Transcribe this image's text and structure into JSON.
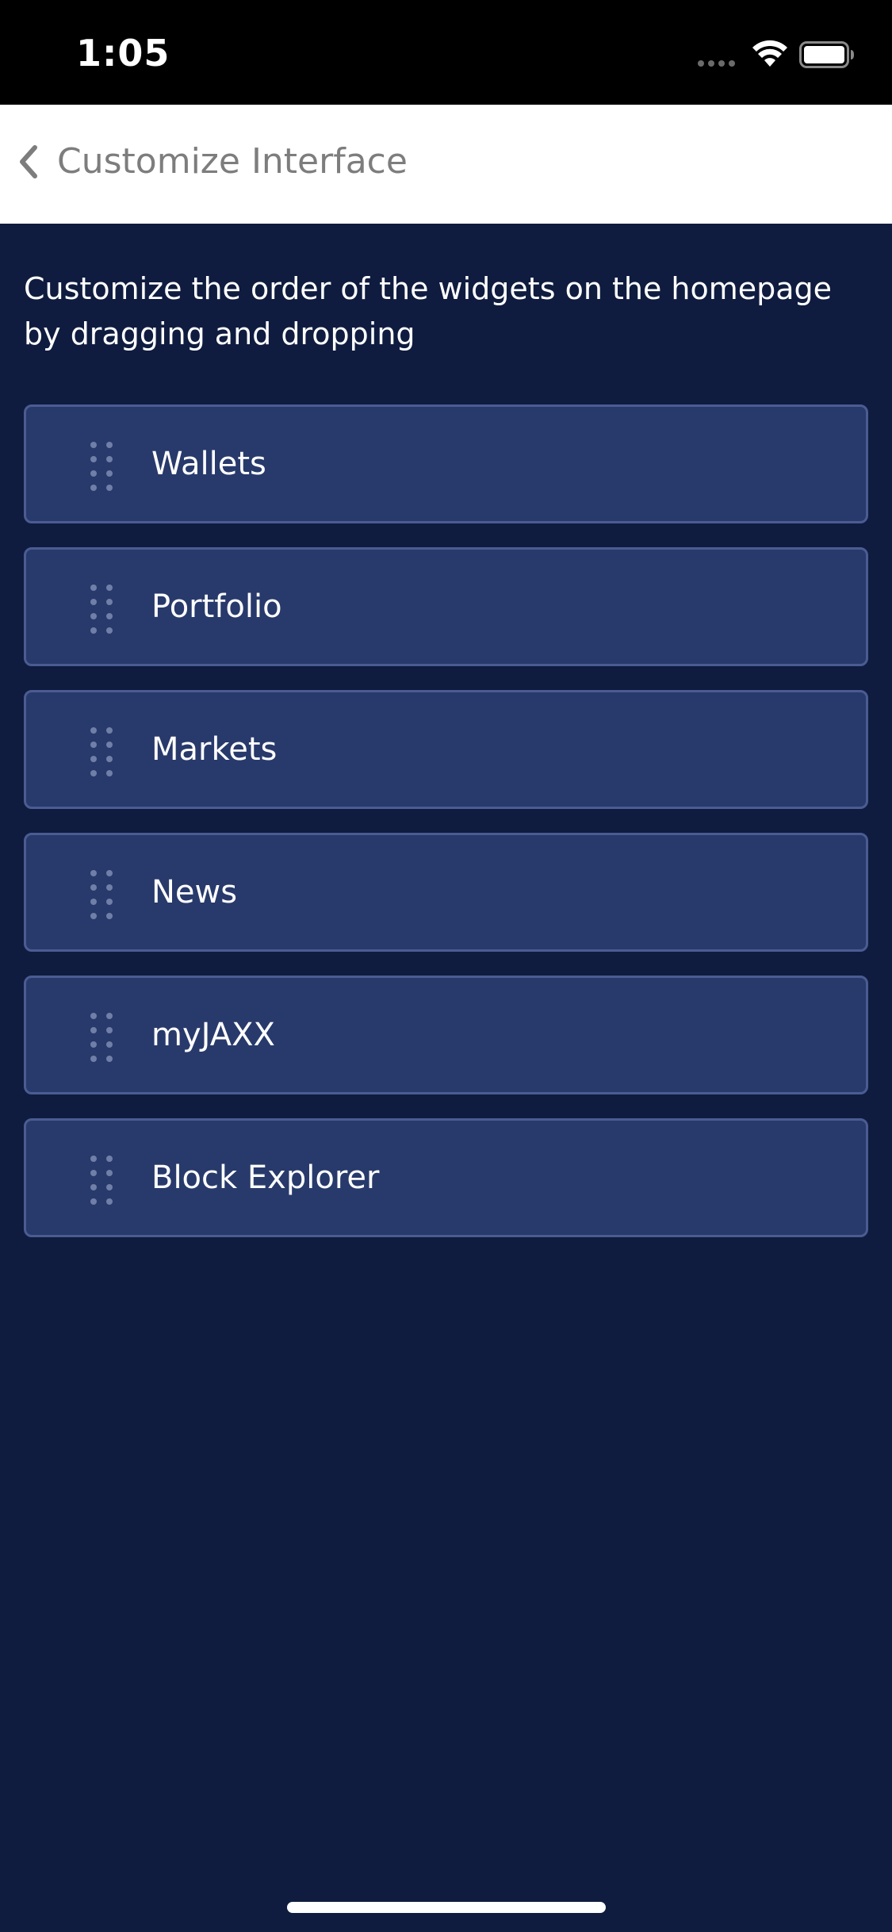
{
  "status_bar": {
    "time": "1:05"
  },
  "header": {
    "title": "Customize Interface",
    "back_icon": "chevron-left-icon"
  },
  "description": "Customize the order of the widgets on the homepage by dragging and dropping",
  "widgets": [
    {
      "label": "Wallets"
    },
    {
      "label": "Portfolio"
    },
    {
      "label": "Markets"
    },
    {
      "label": "News"
    },
    {
      "label": "myJAXX"
    },
    {
      "label": "Block Explorer"
    }
  ],
  "colors": {
    "background": "#0f1c3f",
    "card": "#283a6b",
    "card_border": "#4a5c92",
    "handle_dots": "#6f7fa8",
    "header_bg": "#ffffff",
    "header_text": "#7d7d7d"
  }
}
